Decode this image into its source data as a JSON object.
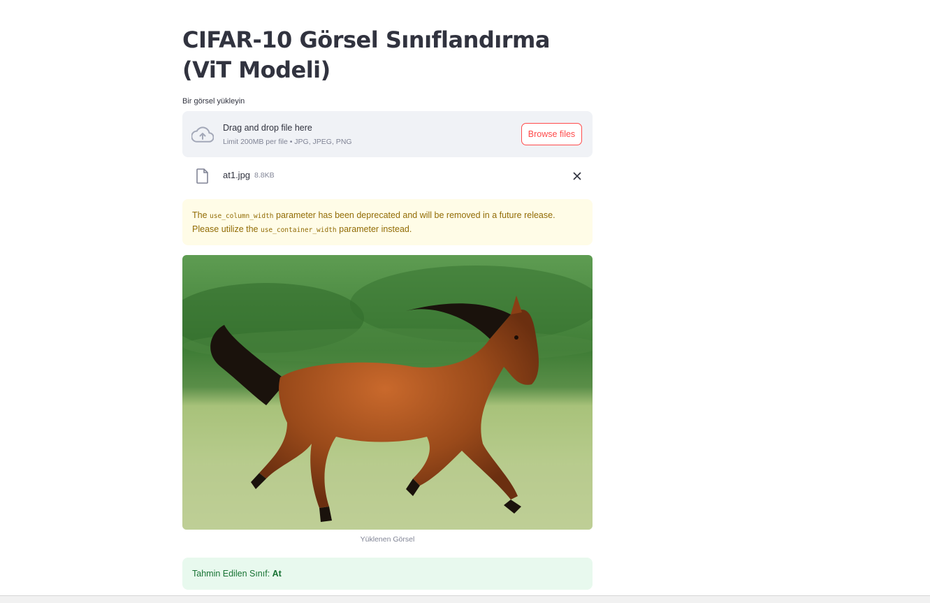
{
  "app": {
    "title": "CIFAR-10 Görsel Sınıflandırma (ViT Modeli)"
  },
  "uploader": {
    "label": "Bir görsel yükleyin",
    "drop_text": "Drag and drop file here",
    "limit_text": "Limit 200MB per file • JPG, JPEG, PNG",
    "browse_label": "Browse files",
    "icon": "cloud-upload-icon"
  },
  "uploaded_file": {
    "name": "at1.jpg",
    "size": "8.8KB",
    "icon": "file-icon"
  },
  "warning": {
    "text_1": "The ",
    "code_1": "use_column_width",
    "text_2": " parameter has been deprecated and will be removed in a future release. Please utilize the ",
    "code_2": "use_container_width",
    "text_3": " parameter instead."
  },
  "image": {
    "caption": "Yüklenen Görsel"
  },
  "result": {
    "label": "Tahmin Edilen Sınıf: ",
    "value": "At"
  },
  "colors": {
    "accent": "#ff4b4b",
    "warning_bg": "#fffce7",
    "warning_text": "#926c05",
    "success_bg": "#e8f9ee",
    "success_text": "#177233",
    "dropzone_bg": "#f0f2f6"
  }
}
